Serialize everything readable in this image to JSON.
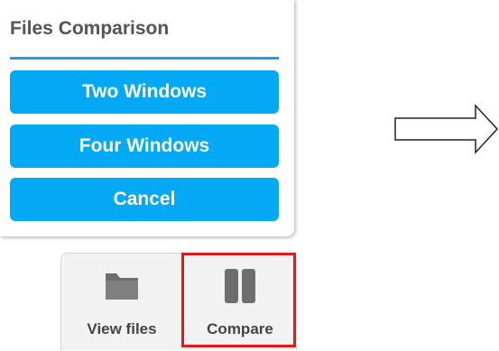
{
  "popup": {
    "title": "Files Comparison",
    "buttons": {
      "two_windows": "Two Windows",
      "four_windows": "Four Windows",
      "cancel": "Cancel"
    }
  },
  "toolbar": {
    "view_files": {
      "label": "View files",
      "icon": "folder-icon"
    },
    "compare": {
      "label": "Compare",
      "icon": "split-view-icon"
    }
  },
  "annotation": {
    "highlight_target": "compare",
    "arrow": "right-arrow-icon"
  },
  "colors": {
    "accent": "#03a9f4",
    "title_rule": "#1aa3ea",
    "highlight": "#e01b1b",
    "icon_gray": "#6e6e6e"
  }
}
